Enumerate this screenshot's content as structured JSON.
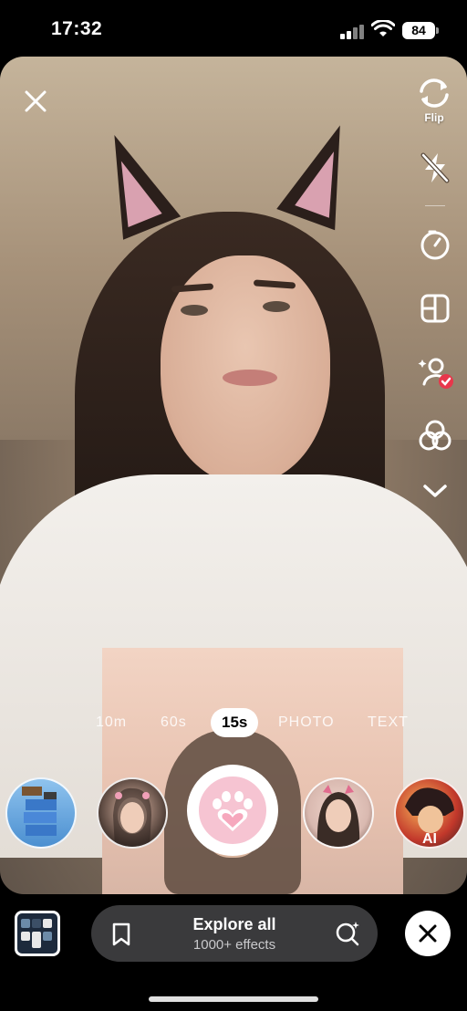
{
  "status_bar": {
    "time": "17:32",
    "battery": "84"
  },
  "camera": {
    "right_tools": {
      "flip_label": "Flip"
    }
  },
  "modes": [
    "10m",
    "60s",
    "15s",
    "PHOTO",
    "TEXT"
  ],
  "active_mode": "15s",
  "effects": [
    {
      "icon": "tower-game-effect"
    },
    {
      "icon": "portrait-effect"
    },
    {
      "icon": "paw-effect"
    },
    {
      "icon": "portrait-effect-2"
    },
    {
      "icon": "anime-ai-effect",
      "badge": "AI"
    }
  ],
  "bottom": {
    "explore_title": "Explore all",
    "explore_sub": "1000+ effects"
  },
  "colors": {
    "accent_pink": "#f6c4d2",
    "check_red": "#e8374b",
    "pill_bg": "#3a3a3c"
  }
}
